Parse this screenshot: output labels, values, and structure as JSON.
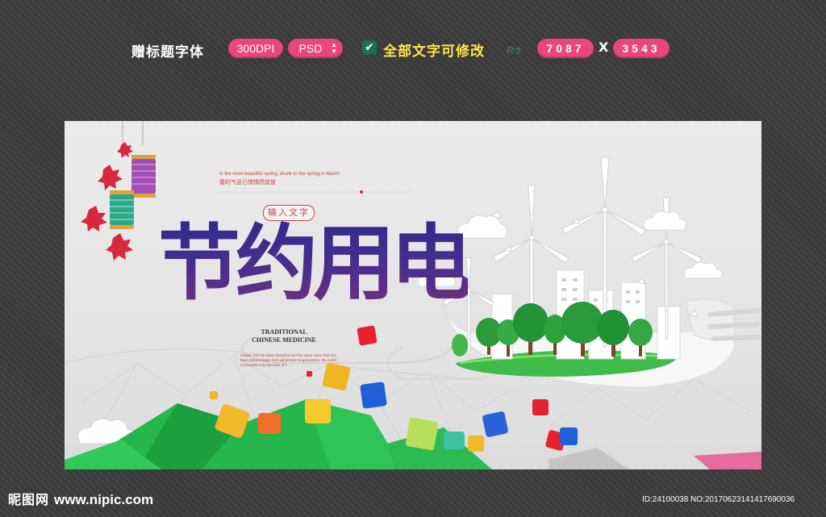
{
  "topbar": {
    "gift_text": "赠标题字体",
    "dpi_label": "300DPI",
    "format_label": "PSD",
    "editable_text": "全部文字可修改",
    "size_label": "尺寸",
    "width_value": "7087",
    "separator": "X",
    "height_value": "3543"
  },
  "poster": {
    "slogan_en": "Is the most beautiful spring, drunk in the spring in March",
    "slogan_cn": "春的气息已悄悄然绽放",
    "input_badge": "输入文字",
    "main_title": "节约用电",
    "subtitle_en": "TRADITIONAL CHINESE MEDICINE",
    "body_copy": "Classic has the same beautiful and the same value that has been passed down from generation to generation, the world is beautiful only because of it"
  },
  "footer": {
    "logo": "昵图网",
    "url": "www.nipic.com",
    "id_text": "ID:24100038 NO:20170623141417690036"
  },
  "colors": {
    "accent_pink": "#e9477a",
    "editable_yellow": "#ffe54a",
    "title_purple": "#3c2a86",
    "grass_green": "#33b04a"
  }
}
